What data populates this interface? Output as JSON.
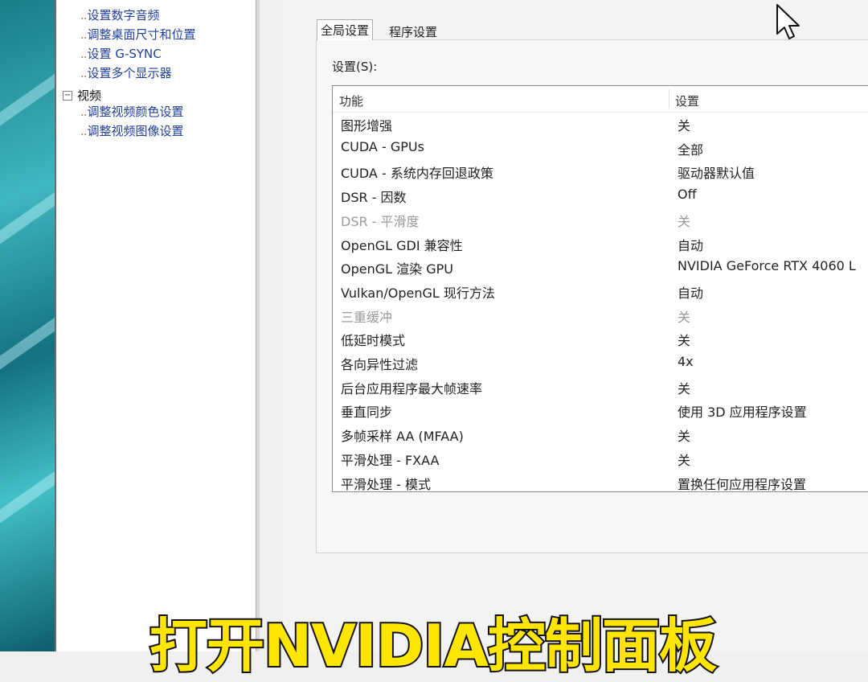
{
  "tree": {
    "items_top": [
      {
        "label": "设置数字音频"
      },
      {
        "label": "调整桌面尺寸和位置"
      },
      {
        "label": "设置 G-SYNC"
      },
      {
        "label": "设置多个显示器"
      }
    ],
    "section_video": {
      "label": "视频",
      "expander": "⊟",
      "children": [
        {
          "label": "调整视频颜色设置"
        },
        {
          "label": "调整视频图像设置"
        }
      ]
    }
  },
  "tabs": [
    {
      "label": "全局设置",
      "active": true
    },
    {
      "label": "程序设置",
      "active": false
    }
  ],
  "settings_label": "设置(S):",
  "list": {
    "columns": [
      "功能",
      "设置"
    ],
    "rows": [
      {
        "feature": "图形增强",
        "value": "关",
        "disabled": false
      },
      {
        "feature": "CUDA - GPUs",
        "value": "全部",
        "disabled": false
      },
      {
        "feature": "CUDA - 系统内存回退政策",
        "value": "驱动器默认值",
        "disabled": false
      },
      {
        "feature": "DSR - 因数",
        "value": "Off",
        "disabled": false
      },
      {
        "feature": "DSR - 平滑度",
        "value": "关",
        "disabled": true
      },
      {
        "feature": "OpenGL GDI 兼容性",
        "value": "自动",
        "disabled": false
      },
      {
        "feature": "OpenGL 渲染 GPU",
        "value": "NVIDIA GeForce RTX 4060 L",
        "disabled": false
      },
      {
        "feature": "Vulkan/OpenGL 现行方法",
        "value": "自动",
        "disabled": false
      },
      {
        "feature": "三重缓冲",
        "value": "关",
        "disabled": true
      },
      {
        "feature": "低延时模式",
        "value": "关",
        "disabled": false
      },
      {
        "feature": "各向异性过滤",
        "value": "4x",
        "disabled": false
      },
      {
        "feature": "后台应用程序最大帧速率",
        "value": "关",
        "disabled": false
      },
      {
        "feature": "垂直同步",
        "value": "使用 3D 应用程序设置",
        "disabled": false
      },
      {
        "feature": "多帧采样 AA (MFAA)",
        "value": "关",
        "disabled": false
      },
      {
        "feature": "平滑处理 - FXAA",
        "value": "关",
        "disabled": false
      },
      {
        "feature": "平滑处理 - 模式",
        "value": "置换任何应用程序设置",
        "disabled": false
      }
    ]
  },
  "subtitle": "打开NVIDIA控制面板",
  "colors": {
    "tree_link": "#1f3f9a",
    "disabled_text": "#9a9a9a",
    "subtitle_fill": "#ffe600",
    "desktop_teal": "#1a7d88"
  }
}
